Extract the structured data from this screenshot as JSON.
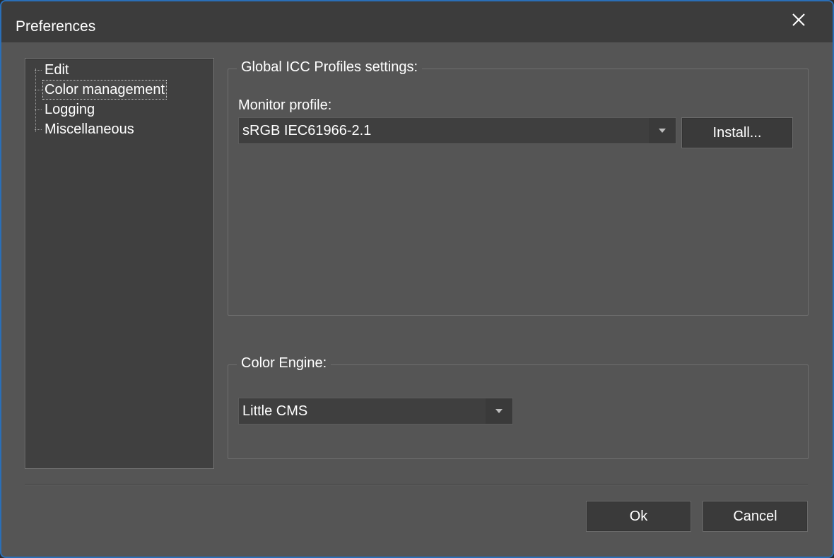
{
  "window": {
    "title": "Preferences",
    "close_icon": "close-icon"
  },
  "sidebar": {
    "items": [
      {
        "label": "Edit",
        "selected": false
      },
      {
        "label": "Color management",
        "selected": true
      },
      {
        "label": "Logging",
        "selected": false
      },
      {
        "label": "Miscellaneous",
        "selected": false
      }
    ]
  },
  "icc_group": {
    "title": "Global ICC Profiles settings:",
    "monitor_profile_label": "Monitor profile:",
    "monitor_profile_value": "sRGB IEC61966-2.1",
    "install_label": "Install..."
  },
  "engine_group": {
    "title": "Color Engine:",
    "engine_value": "Little CMS"
  },
  "footer": {
    "ok_label": "Ok",
    "cancel_label": "Cancel"
  },
  "colors": {
    "window_bg": "#555555",
    "titlebar_bg": "#3c3c3c",
    "accent_border": "#2a6fb8",
    "text": "#ffffff"
  }
}
